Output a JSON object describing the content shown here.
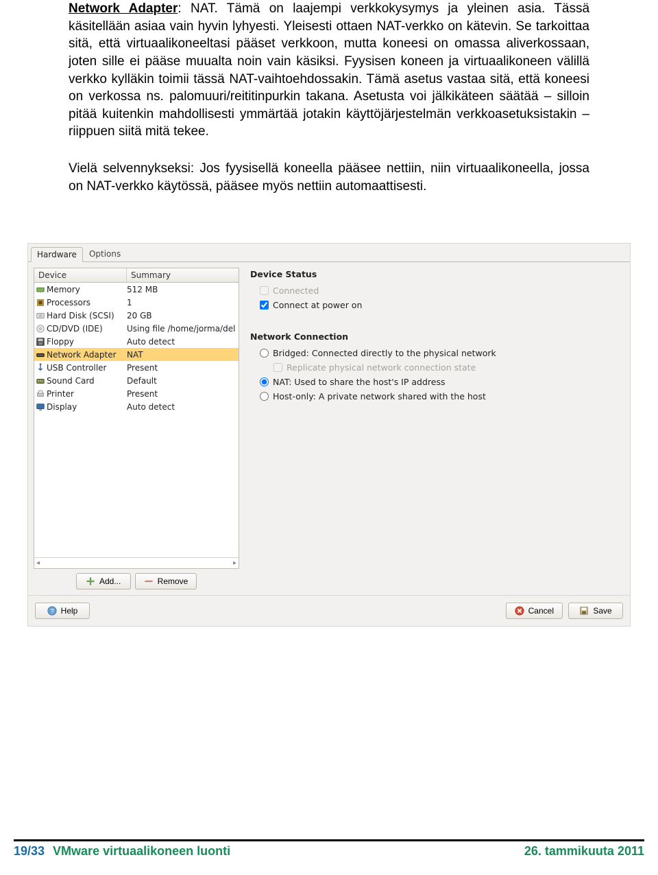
{
  "document": {
    "para1_prefix_bold_u": "Network Adapter",
    "para1_rest": ": NAT. Tämä on laajempi verkkokysymys ja yleinen asia. Tässä käsitellään asiaa vain hyvin lyhyesti. Yleisesti ottaen NAT-verkko on kätevin. Se tarkoittaa sitä, että virtuaalikoneeltasi pääset verkkoon, mutta koneesi on omassa aliverkossaan, joten sille ei pääse muualta noin vain käsiksi. Fyysisen koneen ja virtuaalikoneen välillä verkko kylläkin toimii tässä NAT-vaihtoehdossakin. Tämä asetus vastaa sitä, että koneesi on verkossa ns. palomuuri/reititinpurkin takana. Asetusta voi jälkikäteen säätää – silloin pitää kuitenkin mahdollisesti ymmärtää jotakin käyttöjärjestelmän verkkoasetuksistakin – riippuen siitä mitä tekee.",
    "para2": "Vielä selvennykseksi: Jos fyysisellä koneella pääsee nettiin, niin virtuaalikoneella, jossa on NAT-verkko käytössä, pääsee myös nettiin automaattisesti."
  },
  "dialog": {
    "tabs": {
      "hardware": "Hardware",
      "options": "Options"
    },
    "columns": {
      "device": "Device",
      "summary": "Summary"
    },
    "devices": [
      {
        "icon": "memory-icon",
        "name": "Memory",
        "summary": "512 MB",
        "sel": false
      },
      {
        "icon": "cpu-icon",
        "name": "Processors",
        "summary": "1",
        "sel": false
      },
      {
        "icon": "disk-icon",
        "name": "Hard Disk (SCSI)",
        "summary": "20 GB",
        "sel": false
      },
      {
        "icon": "cd-icon",
        "name": "CD/DVD (IDE)",
        "summary": "Using file /home/jorma/del",
        "sel": false
      },
      {
        "icon": "floppy-icon",
        "name": "Floppy",
        "summary": "Auto detect",
        "sel": false
      },
      {
        "icon": "network-icon",
        "name": "Network Adapter",
        "summary": "NAT",
        "sel": true
      },
      {
        "icon": "usb-icon",
        "name": "USB Controller",
        "summary": "Present",
        "sel": false
      },
      {
        "icon": "sound-icon",
        "name": "Sound Card",
        "summary": "Default",
        "sel": false
      },
      {
        "icon": "printer-icon",
        "name": "Printer",
        "summary": "Present",
        "sel": false
      },
      {
        "icon": "display-icon",
        "name": "Display",
        "summary": "Auto detect",
        "sel": false
      }
    ],
    "buttons": {
      "add": "Add...",
      "remove": "Remove",
      "help": "Help",
      "cancel": "Cancel",
      "save": "Save"
    },
    "right": {
      "status_title": "Device Status",
      "connected": "Connected",
      "connect_power": "Connect at power on",
      "net_title": "Network Connection",
      "bridged": "Bridged: Connected directly to the physical network",
      "replicate": "Replicate physical network connection state",
      "nat": "NAT: Used to share the host's IP address",
      "hostonly": "Host-only: A private network shared with the host"
    }
  },
  "footer": {
    "page": "19/33",
    "title": "VMware virtuaalikoneen luonti",
    "date": "26. tammikuuta 2011"
  }
}
